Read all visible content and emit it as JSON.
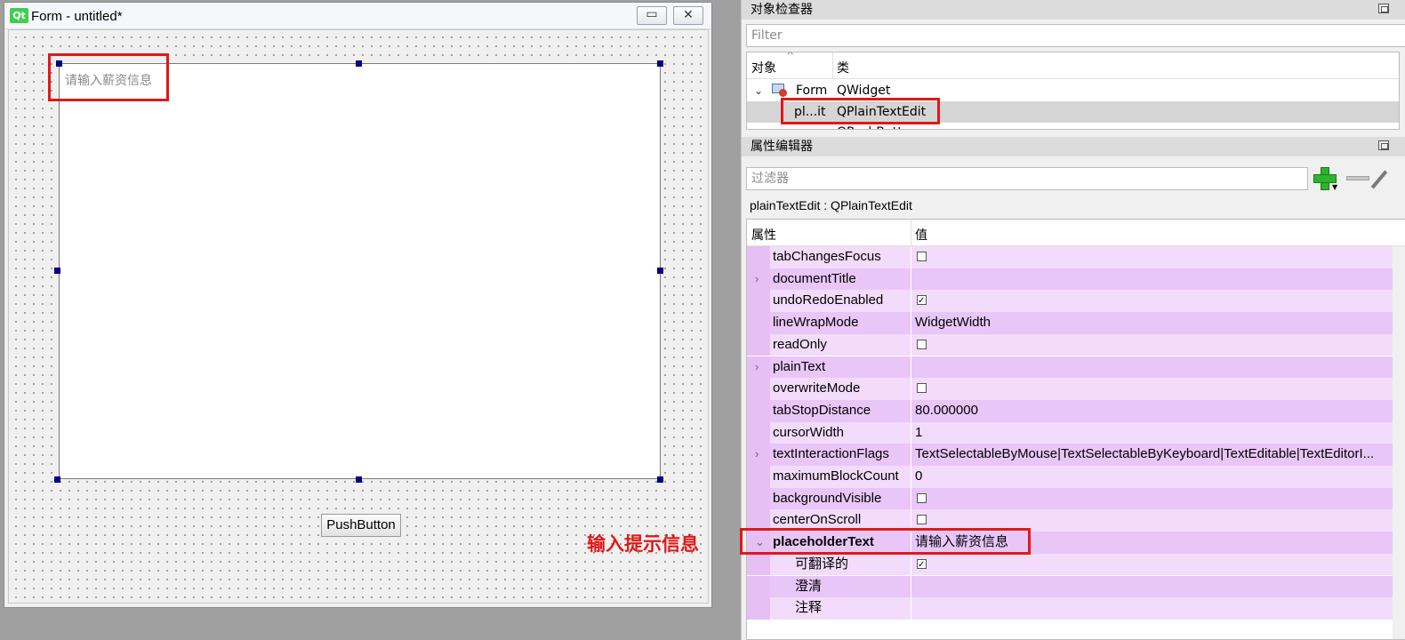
{
  "form_window": {
    "logo": "Qt",
    "title": "Form - untitled*",
    "minimize_glyph": "▭",
    "close_glyph": "✕",
    "plaintextedit_placeholder": "请输入薪资信息",
    "pushbutton_label": "PushButton",
    "annotation": "输入提示信息"
  },
  "object_inspector": {
    "title": "对象检查器",
    "filter_placeholder": "Filter",
    "columns": [
      "对象",
      "类"
    ],
    "rows": [
      {
        "object": "Form",
        "class": "QWidget",
        "expand": "⌄"
      },
      {
        "object": "pl...it",
        "class": "QPlainTextEdit"
      },
      {
        "object": "",
        "class": "QPushButton"
      }
    ]
  },
  "property_editor": {
    "title": "属性编辑器",
    "filter_placeholder": "过滤器",
    "object_label": "plainTextEdit : QPlainTextEdit",
    "columns": [
      "属性",
      "值"
    ],
    "rows": [
      {
        "name": "tabChangesFocus",
        "value": "",
        "checkbox": false
      },
      {
        "name": "documentTitle",
        "value": "",
        "expandable": true
      },
      {
        "name": "undoRedoEnabled",
        "value": "",
        "checkbox": true
      },
      {
        "name": "lineWrapMode",
        "value": "WidgetWidth"
      },
      {
        "name": "readOnly",
        "value": "",
        "checkbox": false
      },
      {
        "name": "plainText",
        "value": "",
        "expandable": true
      },
      {
        "name": "overwriteMode",
        "value": "",
        "checkbox": false
      },
      {
        "name": "tabStopDistance",
        "value": "80.000000"
      },
      {
        "name": "cursorWidth",
        "value": "1"
      },
      {
        "name": "textInteractionFlags",
        "value": "TextSelectableByMouse|TextSelectableByKeyboard|TextEditable|TextEditorI...",
        "expandable": true
      },
      {
        "name": "maximumBlockCount",
        "value": "0"
      },
      {
        "name": "backgroundVisible",
        "value": "",
        "checkbox": false
      },
      {
        "name": "centerOnScroll",
        "value": "",
        "checkbox": false
      },
      {
        "name": "placeholderText",
        "value": "请输入薪资信息",
        "expanded": true
      },
      {
        "name": "可翻译的",
        "value": "",
        "checkbox": true,
        "sub": true
      },
      {
        "name": "澄清",
        "value": "",
        "sub": true
      },
      {
        "name": "注释",
        "value": "",
        "sub": true
      }
    ]
  },
  "colors": {
    "highlight": "#e01818",
    "row_light": "#f3dcfb",
    "row_dark": "#e9c6f8"
  }
}
